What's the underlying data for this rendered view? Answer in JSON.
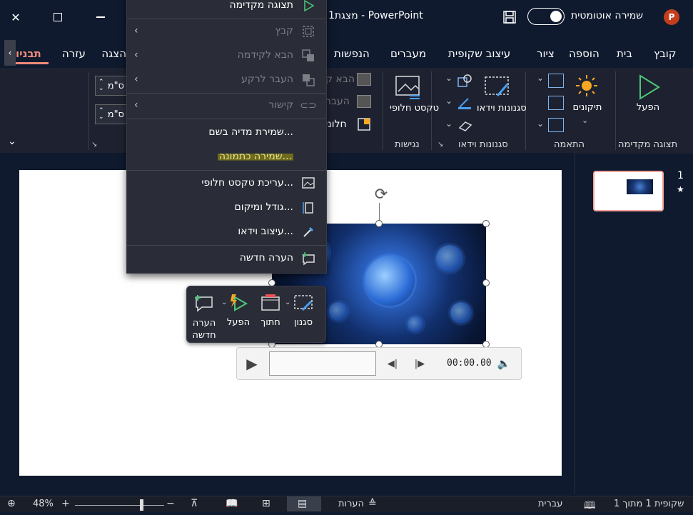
{
  "titlebar": {
    "title": "מצגת1 - PowerPoint",
    "autosave_label": "שמירה אוטומטית",
    "app_logo_letter": "P",
    "icons": [
      "close-icon",
      "restore-icon",
      "minimize-icon",
      "save-icon"
    ]
  },
  "tabs": {
    "items": [
      "קובץ",
      "בית",
      "הוספה",
      "ציור",
      "עיצוב שקופית",
      "מעברים",
      "הנפשות"
    ],
    "left_items": [
      "עזרה",
      "הצגה",
      "תבניו"
    ],
    "active": "תבניו"
  },
  "ribbon": {
    "play_label": "הפעל",
    "corrections_label": "תיקונים",
    "video_styles_label": "סגנונות וידאו",
    "alt_text_label": "טקסט חלופי",
    "group_preview": "תצוגה מקדימה",
    "group_adjust": "התאמה",
    "group_video_styles": "סגנונות וידאו",
    "group_accessibility": "נגישות",
    "partial_labels": {
      "bring_forward": "הבא ק",
      "send_backward": "העבר",
      "selection_pane": "חלוני"
    },
    "height_value": "ס\"מ",
    "width_value": "ס\"מ"
  },
  "context_menu": {
    "items": [
      {
        "label": "תצוגה מקדימה",
        "icon": "play-icon",
        "disabled": false,
        "submenu": false
      },
      {
        "label": "קבץ",
        "icon": "group-icon",
        "disabled": true,
        "submenu": true
      },
      {
        "label": "הבא לקידמה",
        "icon": "bring-front-icon",
        "disabled": true,
        "submenu": true
      },
      {
        "label": "העבר לרקע",
        "icon": "send-back-icon",
        "disabled": true,
        "submenu": true
      },
      {
        "label": "קישור",
        "icon": "link-icon",
        "disabled": true,
        "submenu": true
      },
      {
        "label": "שמירת מדיה בשם...",
        "icon": "",
        "disabled": false,
        "submenu": false
      },
      {
        "label": "שמירה כתמונה...",
        "icon": "",
        "disabled": false,
        "submenu": false,
        "highlighted": true
      },
      {
        "label": "עריכת טקסט חלופי...",
        "icon": "alt-text-icon",
        "disabled": false,
        "submenu": false
      },
      {
        "label": "גודל ומיקום...",
        "icon": "size-position-icon",
        "disabled": false,
        "submenu": false
      },
      {
        "label": "עיצוב וידאו...",
        "icon": "format-video-icon",
        "disabled": false,
        "submenu": false
      },
      {
        "label": "הערה חדשה",
        "icon": "new-comment-icon",
        "disabled": false,
        "submenu": false
      }
    ]
  },
  "mini_toolbar": {
    "style_label": "סגנון",
    "trim_label": "חתוך",
    "play_label": "הפעל",
    "new_comment_label": "הערה חדשה"
  },
  "player": {
    "time": "00:00.00"
  },
  "thumbnails": {
    "slide_number": "1",
    "star": "★"
  },
  "statusbar": {
    "slide_info": "שקופית 1 מתוך 1",
    "language": "עברית",
    "notes_label": "הערות",
    "zoom": "48%",
    "zoom_level": 0.48
  }
}
